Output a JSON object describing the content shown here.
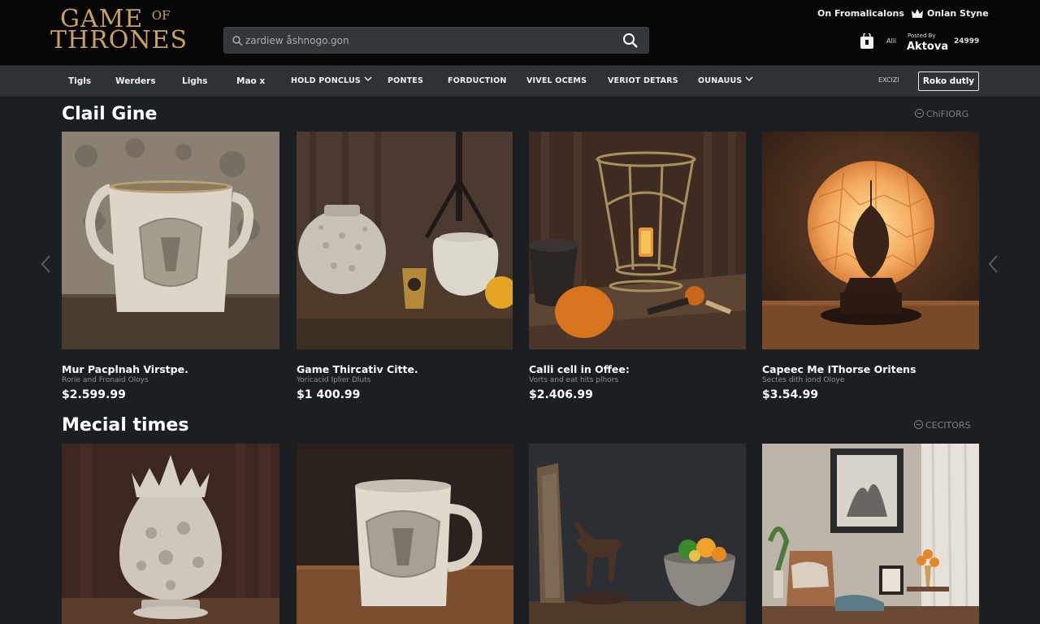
{
  "header": {
    "logo_line1": "GAME",
    "logo_of": "OF",
    "logo_line2": "THRONES",
    "search_placeholder": "zardiew åshnogo.gon",
    "top_link1": "On Fromalicalons",
    "top_link2": "Onlan Styne",
    "left_small": "Alli",
    "posted_by": "Posted By",
    "account_name": "Aktova",
    "right_small": "24999"
  },
  "nav": {
    "items": [
      {
        "label": "Tigls"
      },
      {
        "label": "Werders"
      },
      {
        "label": "Lighs"
      },
      {
        "label": "Mao x"
      },
      {
        "label": "HOLD PONCLUS"
      },
      {
        "label": "PONTES"
      },
      {
        "label": "FORDUCTION"
      },
      {
        "label": "VIVEL OCEMS"
      },
      {
        "label": "VERIOT DETARS"
      },
      {
        "label": "OUNAUUS"
      }
    ],
    "tiny_text": "EXCIZI",
    "button_label": "Roko dutly"
  },
  "sections": [
    {
      "title": "Clail Gine",
      "more_label": "ChiFIORG",
      "products": [
        {
          "name": "Mur Pacplnah Virstpe.",
          "subtitle": "Rorie and Fronaid Oloys",
          "price": "$2.599.99"
        },
        {
          "name": "Game Thircativ Citte.",
          "subtitle": "Yoricacid Iplier Dluts",
          "price": "$1 400.99"
        },
        {
          "name": "Calli cell in Offee:",
          "subtitle": "Vorts and eat hits plhors",
          "price": "$2.406.99"
        },
        {
          "name": "Capeec Me IThorse Oritens",
          "subtitle": "Sectes dith iond Oloye",
          "price": "$3.54.99"
        }
      ]
    },
    {
      "title": "Mecial times",
      "more_label": "CECITORS",
      "products": []
    }
  ],
  "colors": {
    "background": "#1c1f22",
    "header": "#060606",
    "nav": "#2e3236",
    "logo_gold": "#c9a35e"
  }
}
